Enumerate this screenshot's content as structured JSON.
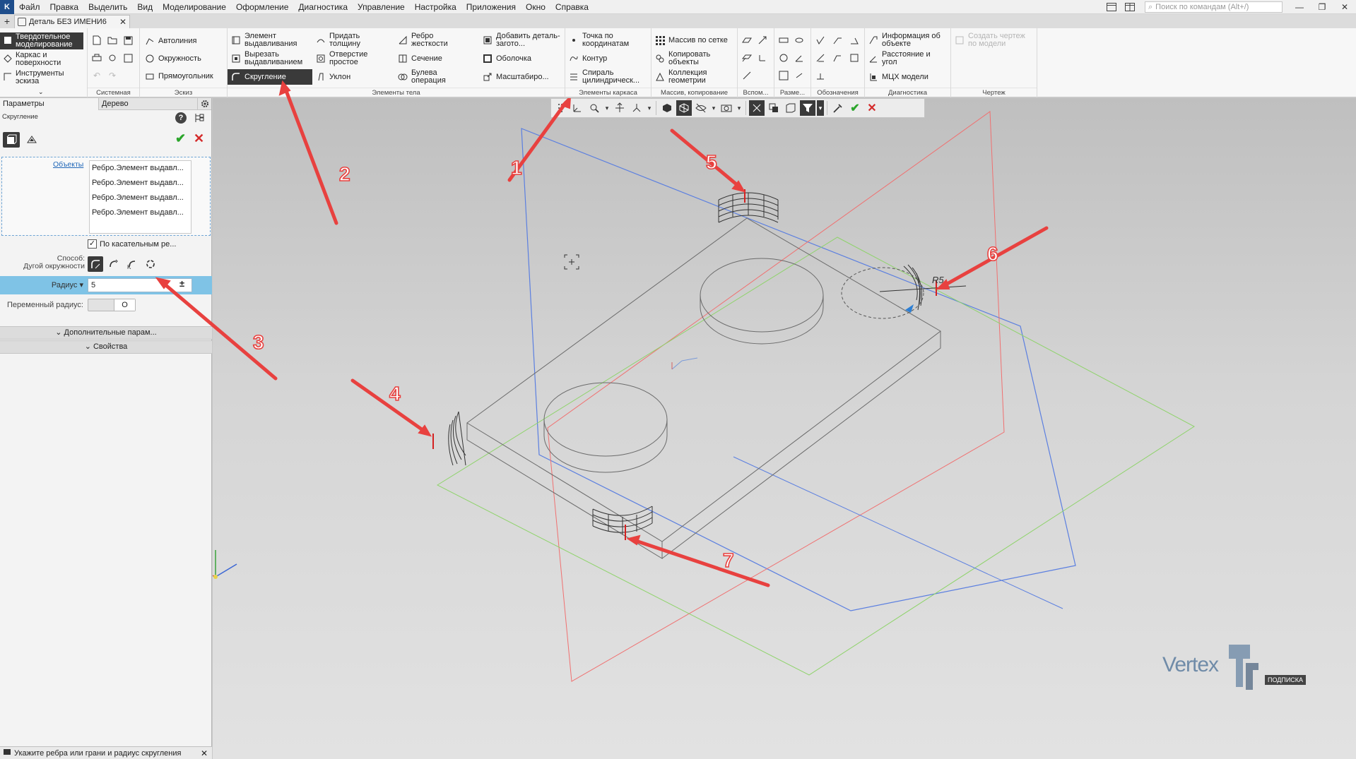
{
  "menu": {
    "items": [
      "Файл",
      "Правка",
      "Выделить",
      "Вид",
      "Моделирование",
      "Оформление",
      "Диагностика",
      "Управление",
      "Настройка",
      "Приложения",
      "Окно",
      "Справка"
    ],
    "search_placeholder": "Поиск по командам (Alt+/)"
  },
  "doc_tab": {
    "title": "Деталь БЕЗ ИМЕНИ6"
  },
  "ribbon": {
    "modes": [
      {
        "label": "Твердотельное моделирование",
        "icon": "solid-cube-icon"
      },
      {
        "label": "Каркас и поверхности",
        "icon": "wireframe-icon"
      },
      {
        "label": "Инструменты эскиза",
        "icon": "sketch-tools-icon"
      }
    ],
    "groups": {
      "system": "Системная",
      "sketch": "Эскиз",
      "body": "Элементы тела",
      "frame": "Элементы каркаса",
      "arrays": "Массив, копирование",
      "aux": "Вспом...",
      "dims": "Разме...",
      "marks": "Обозначения",
      "diag": "Диагностика",
      "drawing": "Чертеж"
    },
    "sketch_buttons": [
      "Автолиния",
      "Окружность",
      "Прямоугольник"
    ],
    "body_buttons": {
      "col1": [
        "Элемент выдавливания",
        "Вырезать выдавливанием",
        "Скругление"
      ],
      "col2": [
        "Придать толщину",
        "Отверстие простое",
        "Уклон"
      ],
      "col3": [
        "Ребро жесткости",
        "Сечение",
        "Булева операция"
      ],
      "col4": [
        "Добавить деталь-загото...",
        "Оболочка",
        "Масштабиро..."
      ]
    },
    "frame_buttons": [
      "Точка по координатам",
      "Контур",
      "Спираль цилиндрическ..."
    ],
    "array_buttons": [
      "Массив по сетке",
      "Копировать объекты",
      "Коллекция геометрии"
    ],
    "diag_buttons": [
      "Информация об объекте",
      "Расстояние и угол",
      "МЦХ модели"
    ],
    "drawing_button": "Создать чертеж по модели"
  },
  "panel": {
    "tabs": [
      "Параметры",
      "Дерево"
    ],
    "operation_title": "Скругление",
    "objects_label": "Объекты",
    "objects": [
      "Ребро.Элемент выдавл...",
      "Ребро.Элемент выдавл...",
      "Ребро.Элемент выдавл...",
      "Ребро.Элемент выдавл..."
    ],
    "tangent_label": "По касательным ре...",
    "tangent_checked": true,
    "method_label": "Способ:",
    "method_value": "Дугой окружности",
    "radius_label": "Радиус",
    "radius_value": "5",
    "radius_pm": "±",
    "var_radius_label": "Переменный радиус:",
    "var_radius_on": false,
    "more_params": "Дополнительные парам...",
    "properties": "Свойства"
  },
  "annotations": {
    "numbers": [
      "1",
      "2",
      "3",
      "4",
      "5",
      "6",
      "7"
    ],
    "dimension_label": "R5",
    "arrow_color": "#e8413f"
  },
  "watermark": {
    "logo": "Vertex",
    "badge": "ПОДПИСКА"
  },
  "status": {
    "hint": "Укажите ребра или грани и радиус скругления"
  },
  "colors": {
    "plane_blue": "#5b7fe0",
    "plane_red": "#f07070",
    "plane_green": "#8ed36a",
    "accent_dark": "#3a3a3a",
    "radius_row": "#7fc3e6"
  }
}
